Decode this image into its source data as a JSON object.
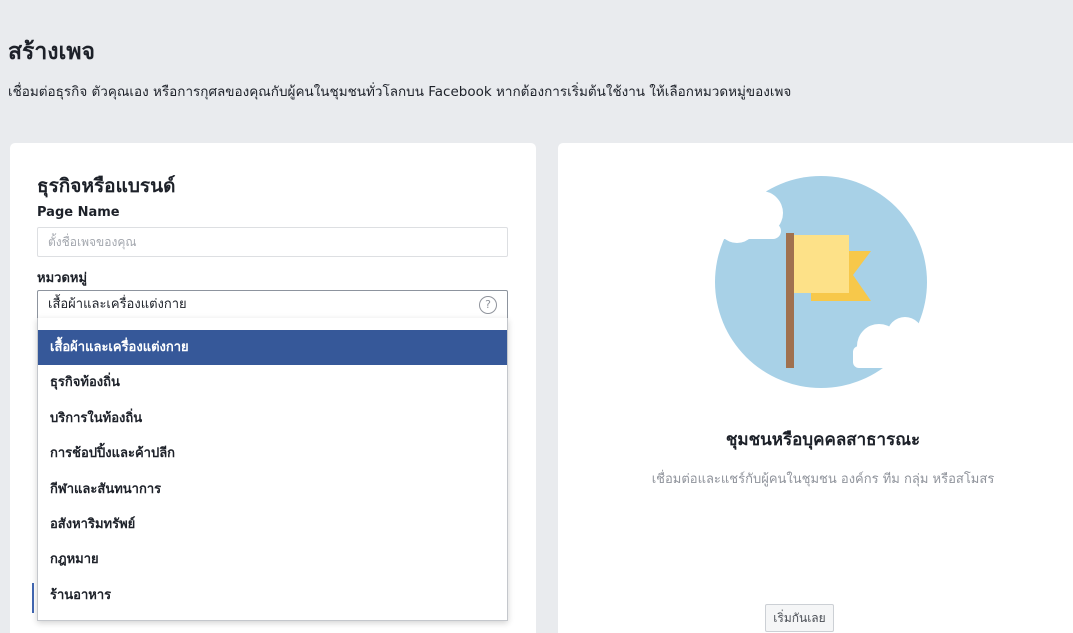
{
  "header": {
    "title": "สร้างเพจ",
    "description": "เชื่อมต่อธุรกิจ ตัวคุณเอง หรือการกุศลของคุณกับผู้คนในชุมชนทั่วโลกบน Facebook หากต้องการเริ่มต้นใช้งาน ให้เลือกหมวดหมู่ของเพจ"
  },
  "business_card": {
    "title": "ธุรกิจหรือแบรนด์",
    "page_name_label": "Page Name",
    "page_name_placeholder": "ตั้งชื่อเพจของคุณ",
    "page_name_value": "",
    "category_label": "หมวดหมู่",
    "category_value": "เสื้อผ้าและเครื่องแต่งกาย",
    "help_icon": "?",
    "dropdown_options": [
      "เสื้อผ้าและเครื่องแต่งกาย",
      "ธุรกิจท้องถิ่น",
      "บริการในท้องถิ่น",
      "การช้อปปิ้งและค้าปลีก",
      "กีฬาและสันทนาการ",
      "อสังหาริมทรัพย์",
      "กฎหมาย",
      "ร้านอาหาร"
    ],
    "selected_option_index": 0
  },
  "community_card": {
    "title": "ชุมชนหรือบุคคลสาธารณะ",
    "description": "เชื่อมต่อและแชร์กับผู้คนในชุมชน องค์กร ทีม กลุ่ม หรือสโมสร",
    "start_button": "เริ่มกันเลย",
    "illustration": "flag-illustration"
  },
  "colors": {
    "background": "#e9ebee",
    "selected_option": "#365899",
    "illustration_circle": "#a8d1e7",
    "flag": "#f7d46e",
    "pole": "#a0714f"
  }
}
